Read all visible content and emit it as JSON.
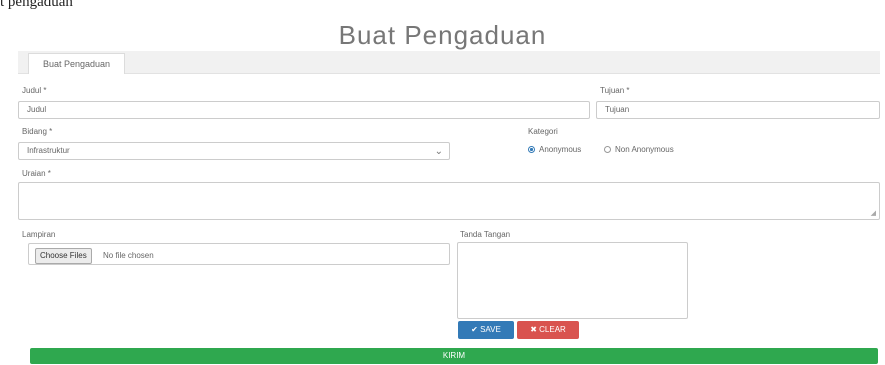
{
  "breadcrumb": "t pengaduan",
  "page_title": "Buat Pengaduan",
  "tab_label": "Buat Pengaduan",
  "fields": {
    "judul": {
      "label": "Judul *",
      "value": "Judul"
    },
    "tujuan": {
      "label": "Tujuan *",
      "value": "Tujuan"
    },
    "bidang": {
      "label": "Bidang *",
      "value": "Infrastruktur"
    },
    "kategori": {
      "label": "Kategori",
      "options": [
        "Anonymous",
        "Non Anonymous"
      ],
      "selected": "Anonymous"
    },
    "uraian": {
      "label": "Uraian *",
      "value": ""
    },
    "lampiran": {
      "label": "Lampiran",
      "button": "Choose Files",
      "status": "No file chosen"
    },
    "ttd": {
      "label": "Tanda Tangan"
    }
  },
  "buttons": {
    "save": "SAVE",
    "clear": "CLEAR",
    "submit": "KIRIM"
  },
  "colors": {
    "save": "#337ab7",
    "clear": "#d9534f",
    "submit": "#2fa84f"
  }
}
